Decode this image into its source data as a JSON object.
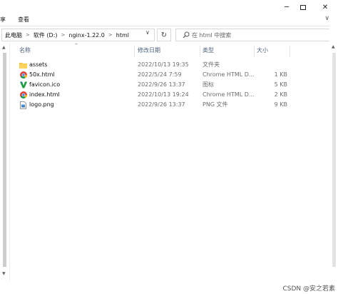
{
  "window": {
    "minimize_glyph": "─",
    "close_glyph": "✕"
  },
  "ribbon": {
    "tab_share": "享",
    "tab_view": "查看",
    "expand_glyph": "∨"
  },
  "address": {
    "crumbs": [
      "此电脑",
      "软件 (D:)",
      "nginx-1.22.0",
      "html"
    ],
    "separator_glyph": ">",
    "dropdown_glyph": "∨",
    "refresh_glyph": "↻"
  },
  "search": {
    "placeholder": "在 html 中搜索"
  },
  "columns": {
    "name": "名称",
    "date": "修改日期",
    "type": "类型",
    "size": "大小",
    "sort_glyph": "^"
  },
  "files": [
    {
      "name": "assets",
      "date": "2022/10/13 19:35",
      "type": "文件夹",
      "size": "",
      "icon": "folder-icon"
    },
    {
      "name": "50x.html",
      "date": "2022/5/24 7:59",
      "type": "Chrome HTML D...",
      "size": "1 KB",
      "icon": "chrome-icon"
    },
    {
      "name": "favicon.ico",
      "date": "2022/9/26 13:37",
      "type": "图标",
      "size": "5 KB",
      "icon": "nginx-v-icon"
    },
    {
      "name": "index.html",
      "date": "2022/10/13 19:24",
      "type": "Chrome HTML D...",
      "size": "2 KB",
      "icon": "chrome-icon"
    },
    {
      "name": "logo.png",
      "date": "2022/9/26 13:37",
      "type": "PNG 文件",
      "size": "9 KB",
      "icon": "image-file-icon"
    }
  ],
  "watermark": "CSDN @安之若素",
  "colors": {
    "folder": "#f4c542",
    "chrome_red": "#db4437",
    "chrome_green": "#0f9d58",
    "chrome_yellow": "#f4b400",
    "chrome_blue": "#4285f4",
    "nginx_green": "#1a9c3c",
    "header_text": "#4c607a"
  }
}
